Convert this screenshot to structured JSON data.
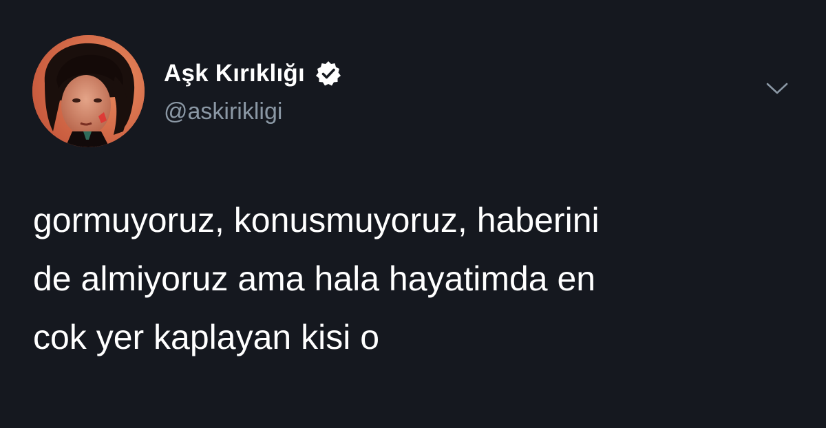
{
  "tweet": {
    "author": {
      "display_name": "Aşk Kırıklığı",
      "username": "@askirikligi",
      "verified": true
    },
    "text_lines": [
      "gormuyoruz, konusmuyoruz, haberini",
      "de almiyoruz ama hala hayatimda en",
      "cok yer kaplayan kisi o"
    ],
    "icons": {
      "verified": "verified-badge-icon",
      "menu": "chevron-down-icon"
    },
    "colors": {
      "background": "#15181f",
      "text": "#ffffff",
      "secondary_text": "#8b98a5",
      "verified_badge": "#ffffff"
    }
  }
}
